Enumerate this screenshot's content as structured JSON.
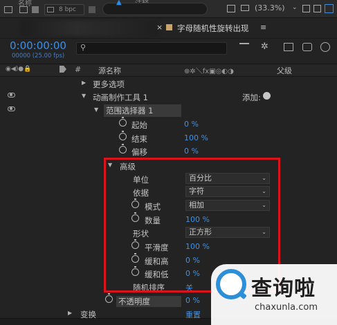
{
  "topbar": {
    "tab_left": "名称",
    "tab_mid": "注释",
    "bpc": "8 bpc",
    "zoom": "(33.3%)"
  },
  "comp": {
    "title": "字母随机性旋转出现",
    "menu_icon": "≡",
    "timecode": "0:00:00:00",
    "frames": "00000 (25.00 fps)",
    "search_placeholder": ""
  },
  "columns": {
    "hash": "#",
    "source_name": "源名称",
    "parent": "父级"
  },
  "rows": {
    "more_options": "更多选项",
    "animator": "动画制作工具 1",
    "add_label": "添加:",
    "range_selector": "范围选择器 1",
    "start": {
      "label": "起始",
      "value": "0 %"
    },
    "end": {
      "label": "结束",
      "value": "100 %"
    },
    "offset": {
      "label": "偏移",
      "value": "0 %"
    },
    "advanced": "高级",
    "units": {
      "label": "单位",
      "value": "百分比"
    },
    "based_on": {
      "label": "依据",
      "value": "字符"
    },
    "mode": {
      "label": "模式",
      "value": "相加"
    },
    "amount": {
      "label": "数量",
      "value": "100 %"
    },
    "shape": {
      "label": "形状",
      "value": "正方形"
    },
    "smoothness": {
      "label": "平滑度",
      "value": "100 %"
    },
    "ease_high": {
      "label": "缓和高",
      "value": "0 %"
    },
    "ease_low": {
      "label": "缓和低",
      "value": "0 %"
    },
    "randomize": {
      "label": "随机排序",
      "value": "关"
    },
    "opacity": {
      "label": "不透明度",
      "value": "0 %"
    },
    "transform": {
      "label": "变换",
      "value": "重置"
    }
  },
  "watermark": {
    "text": "查询啦",
    "url": "chaxunla.com"
  },
  "colors": {
    "accent": "#3e91e8",
    "highlight_box": "#d9141c",
    "watermark_blue": "#2c8fd8"
  }
}
